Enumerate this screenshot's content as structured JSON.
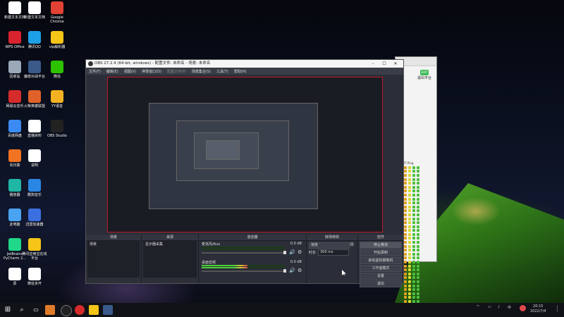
{
  "desktop": {
    "icons": [
      {
        "label": "新建文本文档",
        "color": "#ffffff",
        "icon": "document-icon"
      },
      {
        "label": "新建文本文档",
        "color": "#ffffff",
        "icon": "document-icon"
      },
      {
        "label": "Google Chrome",
        "color": "#e34133",
        "icon": "chrome-icon"
      },
      {
        "label": "WPS Office",
        "color": "#d9232e",
        "icon": "wps-icon"
      },
      {
        "label": "腾讯QQ",
        "color": "#1ea0e6",
        "icon": "qq-icon"
      },
      {
        "label": "vip解析器",
        "color": "#f5c518",
        "icon": "vip-icon"
      },
      {
        "label": "回收站",
        "color": "#9aa8b8",
        "icon": "recycle-bin-icon"
      },
      {
        "label": "魔兽对战平台",
        "color": "#3b5a8a",
        "icon": "game-platform-icon"
      },
      {
        "label": "微信",
        "color": "#2dc100",
        "icon": "wechat-icon"
      },
      {
        "label": "网易云音乐",
        "color": "#d62b2b",
        "icon": "netease-music-icon"
      },
      {
        "label": "火柴英雄联盟",
        "color": "#e0622a",
        "icon": "match-game-icon"
      },
      {
        "label": "YY语音",
        "color": "#f2b221",
        "icon": "yy-icon"
      },
      {
        "label": "百度网盘",
        "color": "#3c8bf5",
        "icon": "baidu-netdisk-icon"
      },
      {
        "label": "直播资料",
        "color": "#ffffff",
        "icon": "document-icon"
      },
      {
        "label": "OBS Studio",
        "color": "#222222",
        "icon": "obs-icon"
      },
      {
        "label": "向日葵",
        "color": "#f27321",
        "icon": "sunflower-icon"
      },
      {
        "label": "说明",
        "color": "#ffffff",
        "icon": "document-icon"
      },
      {
        "label": "播放器",
        "color": "#1fb6a6",
        "icon": "player-icon"
      },
      {
        "label": "酷狗音乐",
        "color": "#2a86e3",
        "icon": "kugou-icon"
      },
      {
        "label": "此电脑",
        "color": "#4aa3f0",
        "icon": "computer-icon"
      },
      {
        "label": "迅雷加速器",
        "color": "#3b6fe0",
        "icon": "accelerator-icon"
      },
      {
        "label": "JetBrains PyCharm 2...",
        "color": "#21d789",
        "icon": "pycharm-icon"
      },
      {
        "label": "腾讯应用宝在线平台",
        "color": "#f5c518",
        "icon": "app-store-icon"
      },
      {
        "label": "原",
        "color": "#ffffff",
        "icon": "document-icon"
      },
      {
        "label": "微信多开",
        "color": "#ffffff",
        "icon": "document-icon"
      }
    ]
  },
  "backwin": {
    "exit_label": "退出平台",
    "badge": "EXIT",
    "grid_header": "IT  Ping"
  },
  "obs": {
    "title": "OBS 27.2.4 (64-bit, windows) - 配置文件: 未命名 - 场景: 未命名",
    "menu": [
      "文件(F)",
      "编辑(E)",
      "视图(V)",
      "停靠窗口(D)",
      "配置文件(P)",
      "场景集合(S)",
      "工具(T)",
      "帮助(H)"
    ],
    "docks": {
      "scenes": {
        "header": "场景",
        "items": [
          "场景"
        ]
      },
      "sources": {
        "header": "来源",
        "items": [
          "显示器采集"
        ]
      },
      "mixer": {
        "header": "混音器",
        "channels": [
          {
            "name": "麦克风/Aux",
            "db": "0.0 dB",
            "level": 0.0
          },
          {
            "name": "桌面音频",
            "db": "0.0 dB",
            "level": 0.55
          }
        ]
      },
      "transitions": {
        "header": "转场特效",
        "type": "渐变",
        "duration_label": "时长",
        "duration": "300 ms"
      },
      "controls": {
        "header": "控件",
        "buttons": [
          "停止推流",
          "开始录制",
          "启动虚拟摄像机",
          "工作室模式",
          "设置",
          "退出"
        ]
      }
    }
  },
  "taskbar": {
    "time": "20:15",
    "date": "2022/7/4"
  }
}
